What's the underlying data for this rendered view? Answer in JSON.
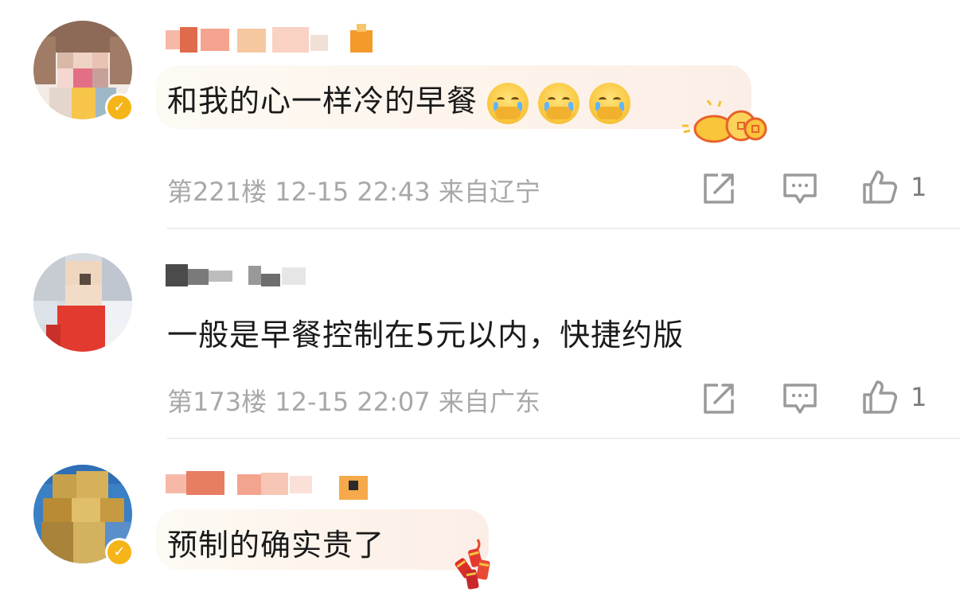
{
  "comments": [
    {
      "text": "和我的心一样冷的早餐",
      "emojis": [
        "crying-cover-mouth-emoji",
        "crying-cover-mouth-emoji",
        "crying-cover-mouth-emoji"
      ],
      "floor": "第221楼",
      "date": "12-15",
      "time": "22:43",
      "location": "来自辽宁",
      "like_count": "1",
      "verified": true,
      "bubble_decoration": "gold-coins-icon"
    },
    {
      "text": "一般是早餐控制在5元以内，快捷约版",
      "emojis": [],
      "floor": "第173楼",
      "date": "12-15",
      "time": "22:07",
      "location": "来自广东",
      "like_count": "1",
      "verified": false
    },
    {
      "text": "预制的确实贵了",
      "emojis": [],
      "verified": true,
      "bubble_decoration": "firecracker-icon"
    }
  ],
  "icons": {
    "share": "share-icon",
    "comment": "comment-icon",
    "like": "thumbs-up-icon"
  },
  "colors": {
    "meta_text": "#a8a8a8",
    "verified_badge": "#f5b418",
    "bubble_start": "#fdfaf4",
    "bubble_end": "#fbeee7"
  }
}
